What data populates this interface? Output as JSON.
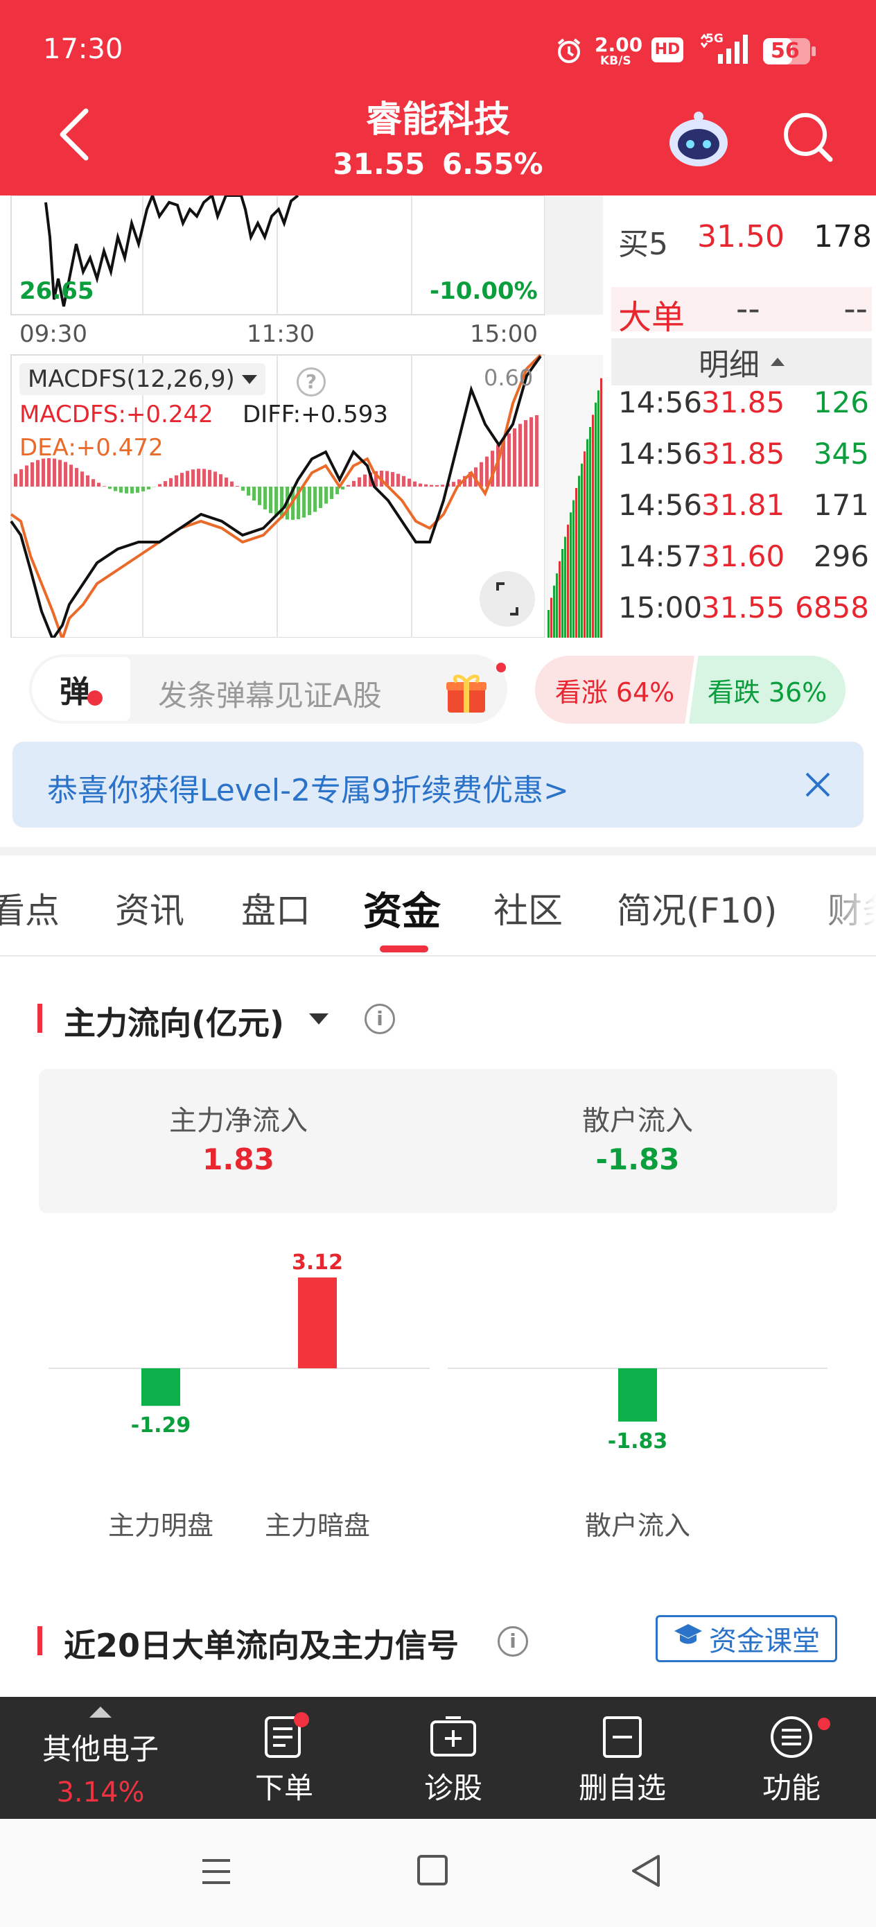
{
  "status_bar": {
    "time": "17:30",
    "net_speed": "2.00",
    "net_unit": "KB/S",
    "hd": "HD",
    "signal": "5G",
    "battery": "56"
  },
  "header": {
    "title": "睿能科技",
    "price": "31.55",
    "change_pct": "6.55%"
  },
  "chart": {
    "low_price": "26.65",
    "low_pct": "-10.00%",
    "times": [
      "09:30",
      "11:30",
      "15:00"
    ],
    "macd_name": "MACDFS(12,26,9)",
    "macd_val": "MACDFS:+0.242",
    "diff_val": "DIFF:+0.593",
    "dea_val": "DEA:+0.472",
    "macd_top": "0.60"
  },
  "orderbook": {
    "buy5_label": "买5",
    "buy5_price": "31.50",
    "buy5_vol": "178",
    "big_order_label": "大单",
    "big_order_price": "--",
    "big_order_vol": "--",
    "detail_label": "明细",
    "trades": [
      {
        "time": "14:56",
        "price": "31.85",
        "vol": "126",
        "dir": "up"
      },
      {
        "time": "14:56",
        "price": "31.85",
        "vol": "345",
        "dir": "up"
      },
      {
        "time": "14:56",
        "price": "31.81",
        "vol": "171",
        "dir": "none"
      },
      {
        "time": "14:57",
        "price": "31.60",
        "vol": "296",
        "dir": "none"
      },
      {
        "time": "15:00",
        "price": "31.55",
        "vol": "6858",
        "dir": "down"
      }
    ]
  },
  "barrage": {
    "badge": "弹",
    "placeholder": "发条弹幕见证A股",
    "up_label": "看涨 64%",
    "down_label": "看跌 36%"
  },
  "banner": {
    "text": "恭喜你获得Level-2专属9折续费优惠>"
  },
  "tabs": [
    "看点",
    "资讯",
    "盘口",
    "资金",
    "社区",
    "简况(F10)",
    "财务"
  ],
  "active_tab": "资金",
  "fund_flow": {
    "title": "主力流向(亿元)",
    "main_inflow_label": "主力净流入",
    "main_inflow_value": "1.83",
    "retail_inflow_label": "散户流入",
    "retail_inflow_value": "-1.83",
    "bar_labels": [
      "主力明盘",
      "主力暗盘",
      "散户流入"
    ],
    "bar_value_labels": [
      "-1.29",
      "3.12",
      "-1.83"
    ]
  },
  "chart_data": [
    {
      "type": "bar",
      "title": "",
      "categories": [
        "主力明盘",
        "主力暗盘"
      ],
      "values": [
        -1.29,
        3.12
      ],
      "colors": [
        "#0cb14b",
        "#f2353b"
      ]
    },
    {
      "type": "bar",
      "title": "",
      "categories": [
        "散户流入"
      ],
      "values": [
        -1.83
      ],
      "colors": [
        "#0cb14b"
      ]
    }
  ],
  "section2": {
    "title": "近20日大单流向及主力信号",
    "course_btn": "资金课堂"
  },
  "bottom_nav": {
    "sector_name": "其他电子",
    "sector_pct": "3.14%",
    "items": [
      "下单",
      "诊股",
      "删自选",
      "功能"
    ]
  },
  "colors": {
    "brand_red": "#f0313f",
    "up_red": "#e8262f",
    "down_green": "#0a9e3d"
  }
}
